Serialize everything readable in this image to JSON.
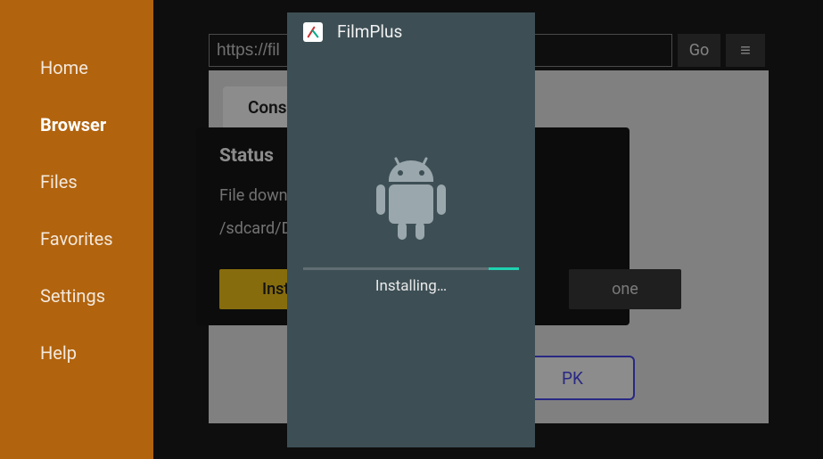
{
  "sidebar": {
    "items": [
      {
        "label": "Home"
      },
      {
        "label": "Browser"
      },
      {
        "label": "Files"
      },
      {
        "label": "Favorites"
      },
      {
        "label": "Settings"
      },
      {
        "label": "Help"
      }
    ],
    "active_index": 1
  },
  "urlbar": {
    "value": "https://fil",
    "go_label": "Go",
    "menu_glyph": "≡"
  },
  "tabs": {
    "first_label": "Cons"
  },
  "status_card": {
    "title": "Status",
    "line1": "File downl",
    "line2": "/sdcard/D",
    "install_label": "Insta",
    "done_label": "one"
  },
  "apk_button": {
    "label": "PK"
  },
  "dialog": {
    "app_name": "FilmPlus",
    "installing_label": "Installing…",
    "progress_percent": 14
  }
}
